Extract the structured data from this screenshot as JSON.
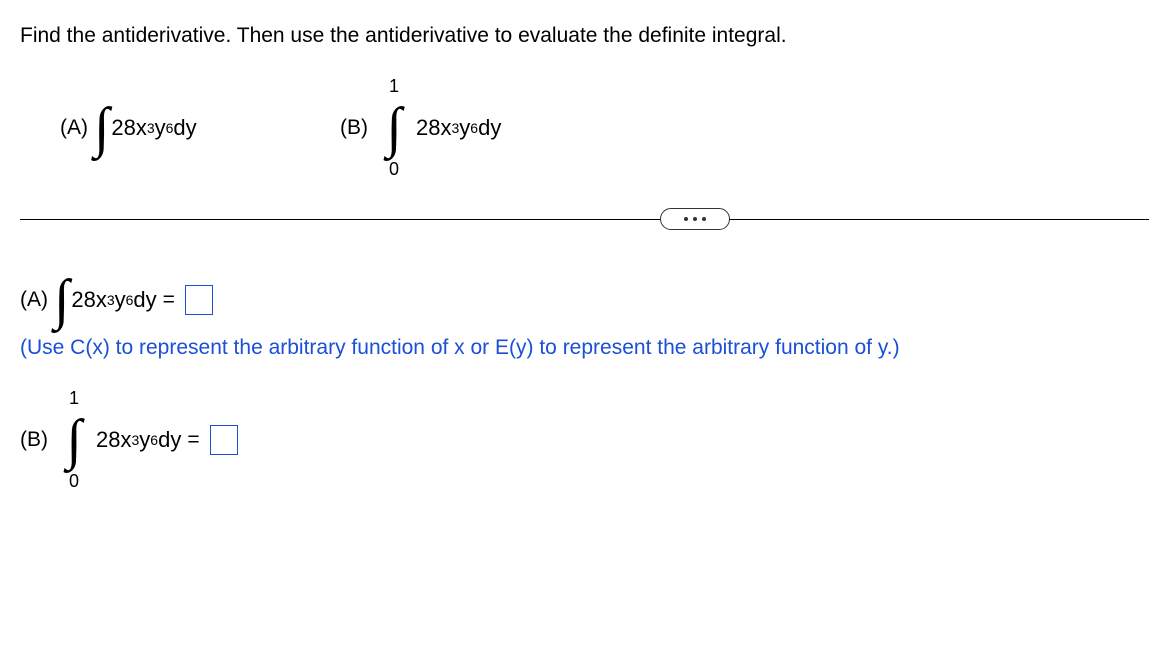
{
  "prompt": "Find the antiderivative. Then use the antiderivative to evaluate the definite integral.",
  "parts": {
    "A": {
      "label": "(A)",
      "coef": "28x",
      "exp1": "3",
      "var2": "y",
      "exp2": "6",
      "diff": "dy"
    },
    "B": {
      "label": "(B)",
      "upper": "1",
      "lower": "0",
      "coef": "28x",
      "exp1": "3",
      "var2": "y",
      "exp2": "6",
      "diff": "dy"
    }
  },
  "dots_label": "more",
  "answerA": {
    "label": "(A)",
    "coef": "28x",
    "exp1": "3",
    "var2": "y",
    "exp2": "6",
    "diff": "dy",
    "eq": "="
  },
  "hint": "(Use C(x) to represent the arbitrary function of x or E(y) to represent the arbitrary function of y.)",
  "answerB": {
    "label": "(B)",
    "upper": "1",
    "lower": "0",
    "coef": "28x",
    "exp1": "3",
    "var2": "y",
    "exp2": "6",
    "diff": "dy",
    "eq": "="
  }
}
